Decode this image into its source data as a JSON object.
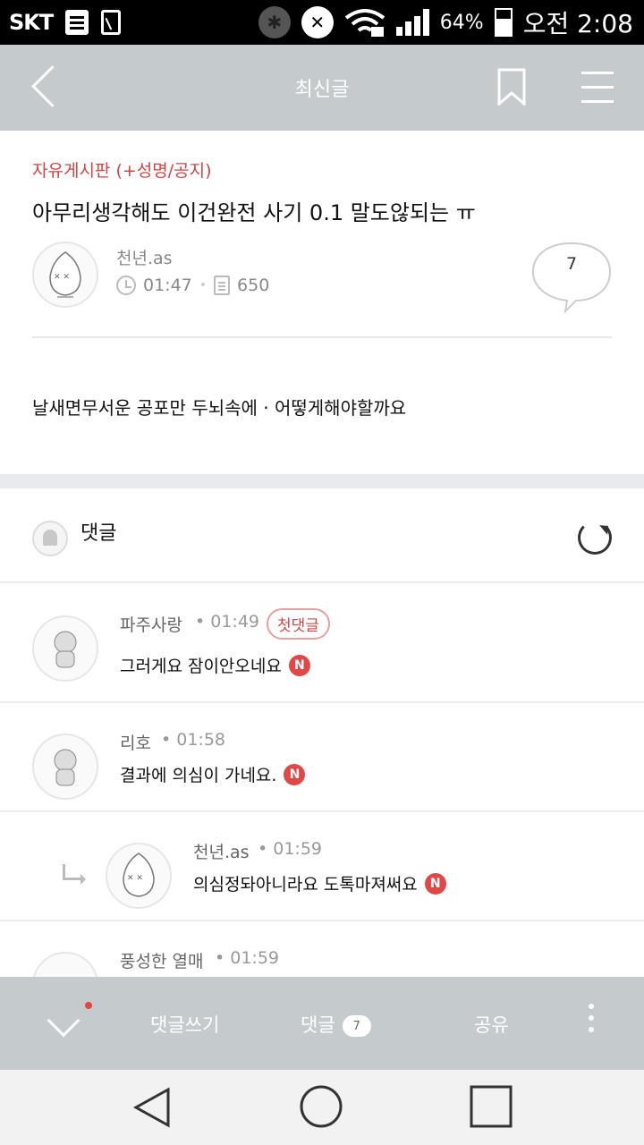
{
  "status_bar": {
    "carrier": "SKT",
    "battery": "64%",
    "time": "오전 2:08"
  },
  "header": {
    "title": "최신글"
  },
  "post": {
    "category": "자유게시판 (+성명/공지)",
    "title": "아무리생각해도 이건완전 사기 0.1 말도않되는 ㅠ",
    "author": "천년.as",
    "time": "01:47",
    "views": "650",
    "comment_count": "7",
    "body": "날새면무서운 공포만 두뇌속에 · 어떻게해야할까요"
  },
  "comments_section": {
    "label": "댓글"
  },
  "comments": [
    {
      "name": "파주사랑",
      "time": "01:49",
      "badge": "첫댓글",
      "text": "그러게요 잠이안오네요",
      "new": "N"
    },
    {
      "name": "리호",
      "time": "01:58",
      "text": "결과에 의심이 가네요.",
      "new": "N"
    },
    {
      "name": "천년.as",
      "time": "01:59",
      "text": "의심정돠아니라요 도톡마져써요",
      "new": "N"
    },
    {
      "name": "풍성한 열매",
      "time": "01:59"
    }
  ],
  "bottom_bar": {
    "write_label": "댓글쓰기",
    "comments_label": "댓글",
    "comments_count": "7",
    "share_label": "공유"
  }
}
